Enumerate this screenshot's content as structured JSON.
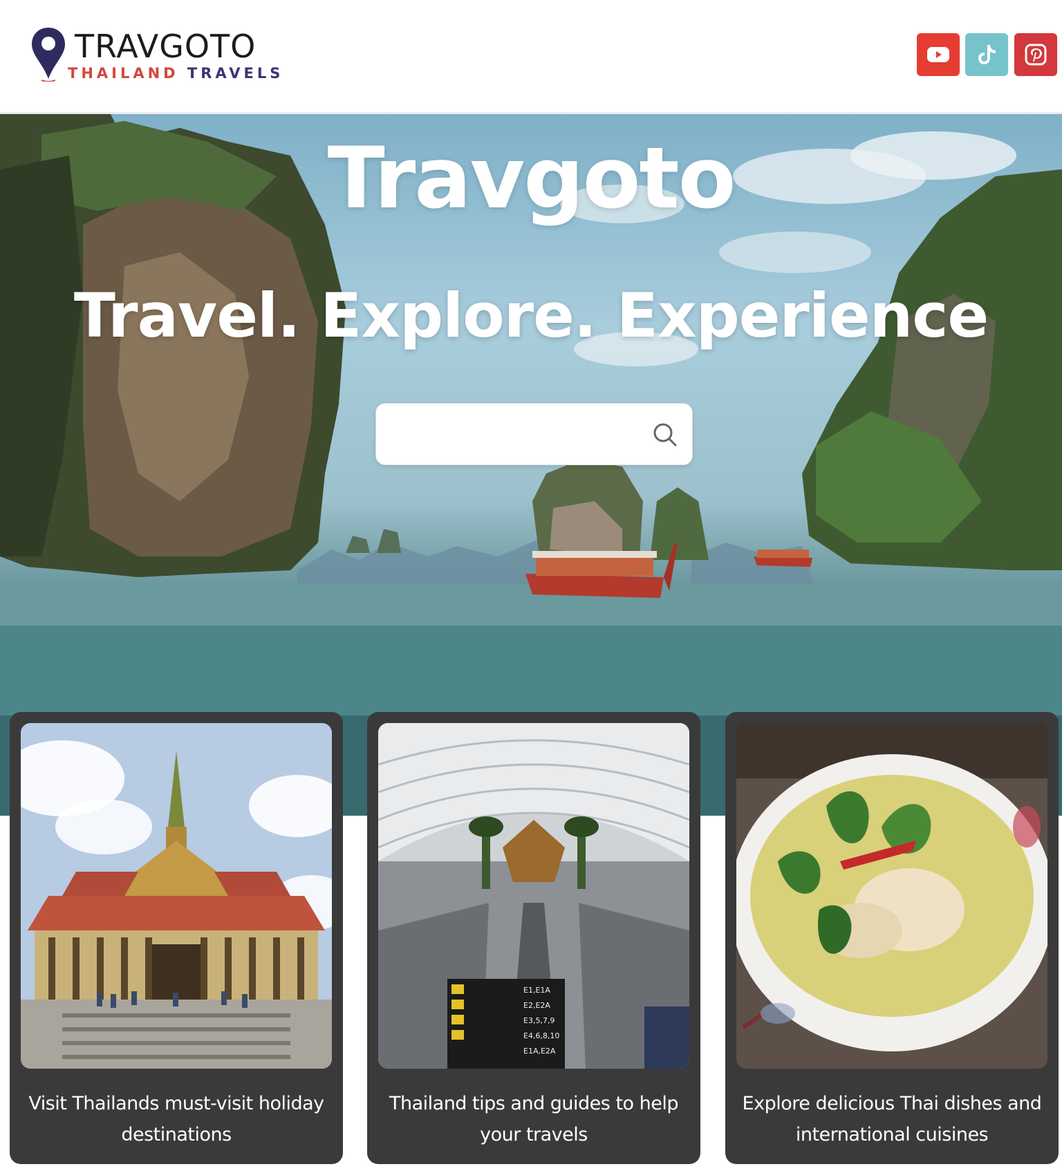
{
  "header": {
    "logo_title": "TRAVGOTO",
    "logo_sub_a": "THAILAND",
    "logo_sub_b": "TRAVELS",
    "social": [
      {
        "name": "youtube",
        "icon": "youtube-icon",
        "color": "#e63c32"
      },
      {
        "name": "tiktok",
        "icon": "tiktok-icon",
        "color": "#76c3cc"
      },
      {
        "name": "pinterest",
        "icon": "pinterest-icon",
        "color": "#d3383c"
      }
    ]
  },
  "hero": {
    "title": "Travgoto",
    "tagline": "Travel. Explore. Experience",
    "search": {
      "placeholder": "",
      "value": "",
      "icon": "search-icon"
    }
  },
  "cards": [
    {
      "text": "Visit Thailands must-visit holiday destinations",
      "image": "thai-temple-photo"
    },
    {
      "text": "Thailand tips and guides to help your travels",
      "image": "airport-terminal-photo",
      "signs": [
        "E1,E1A",
        "E2,E2A",
        "E3,5,7,9",
        "E4,6,8,10",
        "E1A,E2A"
      ]
    },
    {
      "text": "Explore delicious Thai dishes and international cuisines",
      "image": "green-curry-photo"
    }
  ],
  "colors": {
    "card_bg": "#3a3a3b",
    "logo_red": "#d2493c",
    "logo_navy": "#3b3573"
  }
}
